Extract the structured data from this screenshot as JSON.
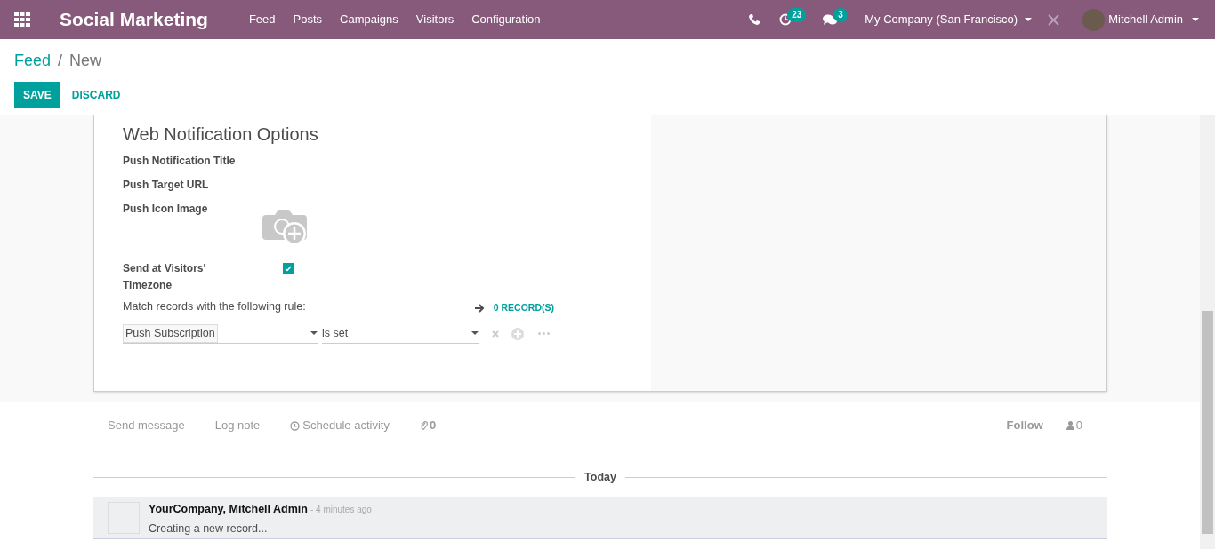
{
  "navbar": {
    "app_title": "Social Marketing",
    "menu": [
      "Feed",
      "Posts",
      "Campaigns",
      "Visitors",
      "Configuration"
    ],
    "activity_count": "23",
    "message_count": "3",
    "company": "My Company (San Francisco)",
    "user": "Mitchell Admin"
  },
  "breadcrumb": {
    "parent": "Feed",
    "separator": "/",
    "current": "New"
  },
  "buttons": {
    "save": "SAVE",
    "discard": "DISCARD"
  },
  "form": {
    "section_title": "Web Notification Options",
    "fields": [
      {
        "kind": "text",
        "label": "Push Notification Title"
      },
      {
        "kind": "text",
        "label": "Push Target URL"
      },
      {
        "kind": "image",
        "label": "Push Icon Image"
      },
      {
        "kind": "checkbox",
        "label": "Send at Visitors' Timezone",
        "checked": true
      }
    ],
    "rule_label": "Match records with the following rule:",
    "record_count": "0 RECORD(S)",
    "rule": {
      "field": "Push Subscription",
      "operator": "is set"
    }
  },
  "chatter": {
    "actions": [
      "Send message",
      "Log note",
      "Schedule activity"
    ],
    "attachments": "0",
    "follow": "Follow",
    "followers": "0",
    "date_separator": "Today",
    "messages": [
      {
        "author": "YourCompany, Mitchell Admin",
        "time": "- 4 minutes ago",
        "body": "Creating a new record..."
      }
    ]
  }
}
